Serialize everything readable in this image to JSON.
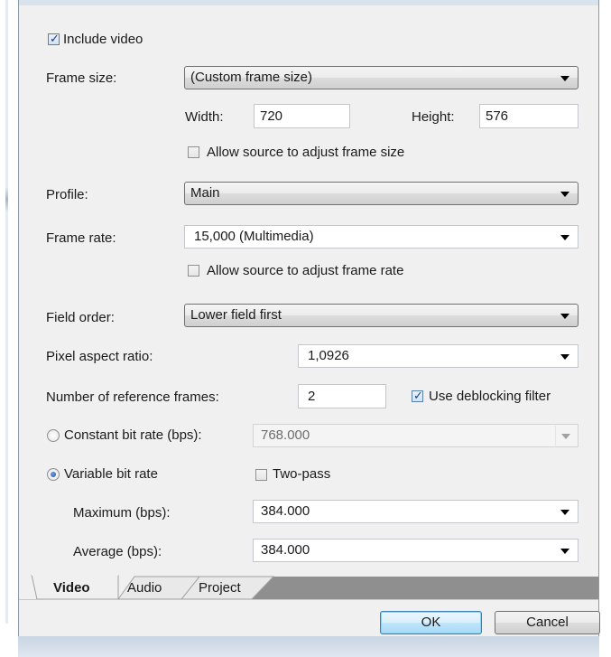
{
  "video": {
    "include_video": {
      "label": "Include video",
      "checked": true
    },
    "frame_size": {
      "label": "Frame size:",
      "value": "(Custom frame size)"
    },
    "width": {
      "label": "Width:",
      "value": "720"
    },
    "height": {
      "label": "Height:",
      "value": "576"
    },
    "allow_frame_size": {
      "label": "Allow source to adjust frame size",
      "checked": false
    },
    "profile": {
      "label": "Profile:",
      "value": "Main"
    },
    "frame_rate": {
      "label": "Frame rate:",
      "value": "15,000 (Multimedia)"
    },
    "allow_frame_rate": {
      "label": "Allow source to adjust frame rate",
      "checked": false
    },
    "field_order": {
      "label": "Field order:",
      "value": "Lower field first"
    },
    "pixel_aspect": {
      "label": "Pixel aspect ratio:",
      "value": "1,0926"
    },
    "ref_frames": {
      "label": "Number of reference frames:",
      "value": "2"
    },
    "deblocking": {
      "label": "Use deblocking filter",
      "checked": true
    },
    "constant_bitrate": {
      "label": "Constant bit rate (bps):",
      "value": "768.000",
      "selected": false
    },
    "variable_bitrate": {
      "label": "Variable bit rate",
      "selected": true
    },
    "two_pass": {
      "label": "Two-pass",
      "checked": false
    },
    "maximum": {
      "label": "Maximum (bps):",
      "value": "384.000"
    },
    "average": {
      "label": "Average (bps):",
      "value": "384.000"
    }
  },
  "tabs": [
    {
      "label": "Video",
      "active": true
    },
    {
      "label": "Audio",
      "active": false
    },
    {
      "label": "Project",
      "active": false
    }
  ],
  "buttons": {
    "ok": "OK",
    "cancel": "Cancel"
  },
  "colors": {
    "panel": "#f0f0f0",
    "accent": "#3c7fb1",
    "tab_strip_shadow": "#8f8f8f"
  }
}
